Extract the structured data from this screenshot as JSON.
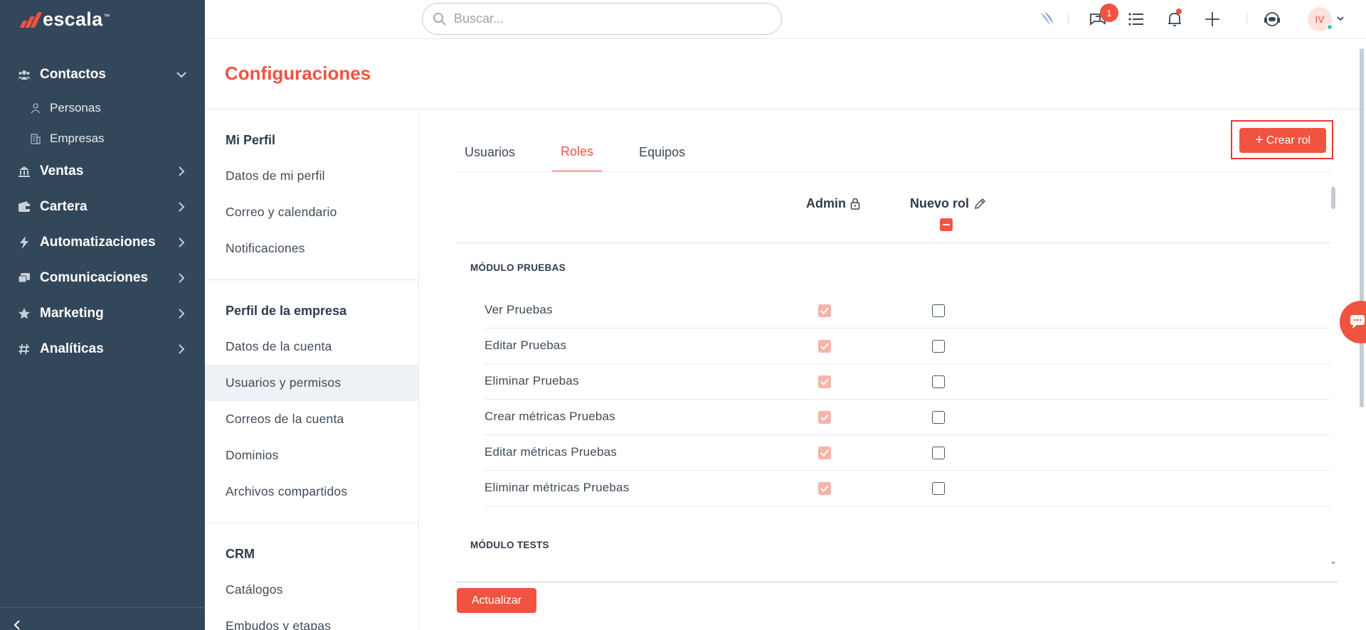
{
  "app": {
    "logo_text": "escala",
    "logo_tm": "™"
  },
  "sidebar": {
    "items": [
      {
        "label": "Contactos",
        "icon": "users-icon",
        "expanded": true
      },
      {
        "label": "Ventas",
        "icon": "bank-icon"
      },
      {
        "label": "Cartera",
        "icon": "wallet-icon"
      },
      {
        "label": "Automatizaciones",
        "icon": "bolt-icon"
      },
      {
        "label": "Comunicaciones",
        "icon": "chat-icon"
      },
      {
        "label": "Marketing",
        "icon": "star-icon"
      },
      {
        "label": "Analíticas",
        "icon": "hash-icon"
      }
    ],
    "sub_items": [
      {
        "label": "Personas",
        "icon": "person-icon"
      },
      {
        "label": "Empresas",
        "icon": "building-icon"
      }
    ]
  },
  "topbar": {
    "search_placeholder": "Buscar...",
    "notification_count": "1",
    "avatar_initials": "IV"
  },
  "page": {
    "title": "Configuraciones"
  },
  "settings_menu": {
    "sections": [
      {
        "header": "Mi Perfil",
        "items": [
          "Datos de mi perfil",
          "Correo y calendario",
          "Notificaciones"
        ]
      },
      {
        "header": "Perfil de la empresa",
        "items": [
          "Datos de la cuenta",
          "Usuarios y permisos",
          "Correos de la cuenta",
          "Dominios",
          "Archivos compartidos"
        ]
      },
      {
        "header": "CRM",
        "items": [
          "Catálogos",
          "Embudos y etapas"
        ]
      }
    ],
    "active_item": "Usuarios y permisos"
  },
  "tabs": [
    "Usuarios",
    "Roles",
    "Equipos"
  ],
  "active_tab": "Roles",
  "create_role_label": "Crear rol",
  "columns": {
    "admin": "Admin",
    "new_role": "Nuevo rol"
  },
  "modules": [
    {
      "title": "MÓDULO PRUEBAS",
      "permissions": [
        {
          "label": "Ver Pruebas",
          "admin": true,
          "new_role": false
        },
        {
          "label": "Editar Pruebas",
          "admin": true,
          "new_role": false
        },
        {
          "label": "Eliminar Pruebas",
          "admin": true,
          "new_role": false
        },
        {
          "label": "Crear métricas Pruebas",
          "admin": true,
          "new_role": false
        },
        {
          "label": "Editar métricas Pruebas",
          "admin": true,
          "new_role": false
        },
        {
          "label": "Eliminar métricas Pruebas",
          "admin": true,
          "new_role": false
        }
      ]
    },
    {
      "title": "MÓDULO TESTS",
      "permissions": []
    }
  ],
  "update_label": "Actualizar",
  "colors": {
    "accent": "#f0533f",
    "sidebar_bg": "#33475b",
    "admin_checkbox": "#f7b4a9"
  }
}
